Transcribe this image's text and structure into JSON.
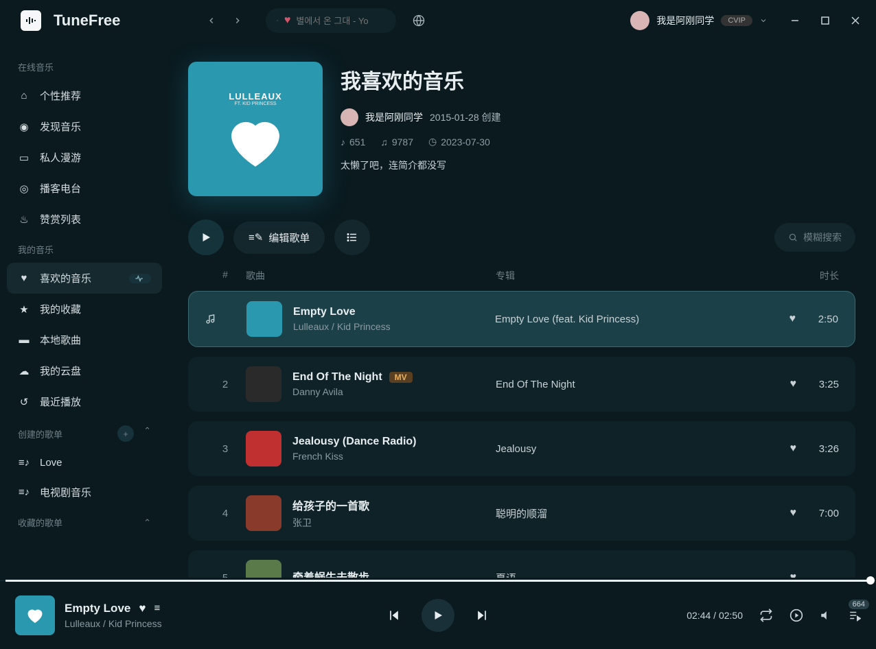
{
  "brand": "TuneFree",
  "search_placeholder": "별에서 온 그대 - Yo",
  "user": {
    "name": "我是阿刚同学",
    "vip": "CVIP"
  },
  "sidebar": {
    "group_online": "在线音乐",
    "group_my": "我的音乐",
    "group_created": "创建的歌单",
    "group_fav": "收藏的歌单",
    "online": [
      {
        "label": "个性推荐"
      },
      {
        "label": "发现音乐"
      },
      {
        "label": "私人漫游"
      },
      {
        "label": "播客电台"
      },
      {
        "label": "赞赏列表"
      }
    ],
    "my": [
      {
        "label": "喜欢的音乐"
      },
      {
        "label": "我的收藏"
      },
      {
        "label": "本地歌曲"
      },
      {
        "label": "我的云盘"
      },
      {
        "label": "最近播放"
      }
    ],
    "created": [
      {
        "label": "Love"
      },
      {
        "label": "电视剧音乐"
      }
    ]
  },
  "playlist": {
    "title": "我喜欢的音乐",
    "cover_title": "LULLEAUX",
    "cover_sub": "FT. KID PRINCESS",
    "owner": "我是阿刚同学",
    "created": "2015-01-28 创建",
    "songs": "651",
    "plays": "9787",
    "updated": "2023-07-30",
    "desc": "太懒了吧，连简介都没写",
    "edit_label": "编辑歌单",
    "fuzzy_label": "模糊搜索"
  },
  "columns": {
    "num": "#",
    "song": "歌曲",
    "album": "专辑",
    "duration": "时长"
  },
  "tracks": [
    {
      "title": "Empty Love",
      "artist": "Lulleaux / Kid Princess",
      "album": "Empty Love (feat. Kid Princess)",
      "duration": "2:50",
      "thumb_bg": "#2a99b0"
    },
    {
      "title": "End Of The Night",
      "artist": "Danny Avila",
      "album": "End Of The Night",
      "duration": "3:25",
      "mv": "MV",
      "thumb_bg": "#2a2a2a"
    },
    {
      "title": "Jealousy (Dance Radio)",
      "artist": "French Kiss",
      "album": "Jealousy",
      "duration": "3:26",
      "thumb_bg": "#c03030"
    },
    {
      "title": "给孩子的一首歌",
      "artist": "张卫",
      "album": "聪明的顺溜",
      "duration": "7:00",
      "thumb_bg": "#8a3a2a"
    },
    {
      "title": "牵着蜗牛去散步",
      "artist": "",
      "album": "夏语",
      "duration": "",
      "thumb_bg": "#5a7a4a"
    }
  ],
  "now_playing": {
    "title": "Empty Love",
    "artist": "Lulleaux / Kid Princess",
    "elapsed": "02:44",
    "total": "02:50",
    "queue_count": "664"
  }
}
